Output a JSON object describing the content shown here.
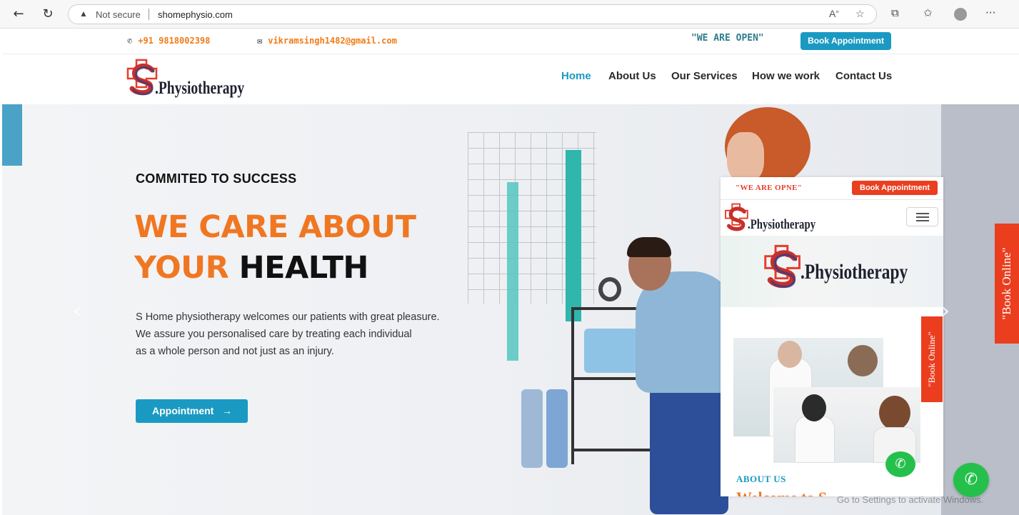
{
  "browser": {
    "security_label": "Not secure",
    "url": "shomephysio.com"
  },
  "topbar": {
    "phone": "+91 9818002398",
    "email": "vikramsingh1482@gmail.com",
    "open_text": "\"WE ARE OPEN\"",
    "book_label": "Book Appointment"
  },
  "nav": {
    "logo_text": ".Physiotherapy",
    "items": [
      {
        "label": "Home"
      },
      {
        "label": "About Us"
      },
      {
        "label": "Our Services"
      },
      {
        "label": "How we work"
      },
      {
        "label": "Contact Us"
      }
    ]
  },
  "hero": {
    "kicker": "COMMITED TO SUCCESS",
    "headline_1": "WE CARE ABOUT",
    "headline_2a": "YOUR",
    "headline_2b": "HEALTH",
    "para_1": "S Home physiotherapy welcomes our patients with great pleasure.",
    "para_2": "We assure you personalised care by treating each individual",
    "para_3": "as a whole person and not just as an injury.",
    "cta": "Appointment"
  },
  "mobile_preview": {
    "open_text": "\"WE ARE OPNE\"",
    "book_label": "Book Appointment",
    "logo_text": ".Physiotherapy",
    "banner_logo_text": ".Physiotherapy",
    "about_label": "ABOUT US",
    "welcome_text": "Welcome to S",
    "side_book": "\"Book Online\""
  },
  "side_book": "\"Book Online\"",
  "watermark": "Go to Settings to activate Windows.",
  "colors": {
    "accent_blue": "#1a9ac2",
    "accent_orange": "#f07722",
    "book_red": "#ea3e1f",
    "whatsapp_green": "#25c04c"
  }
}
